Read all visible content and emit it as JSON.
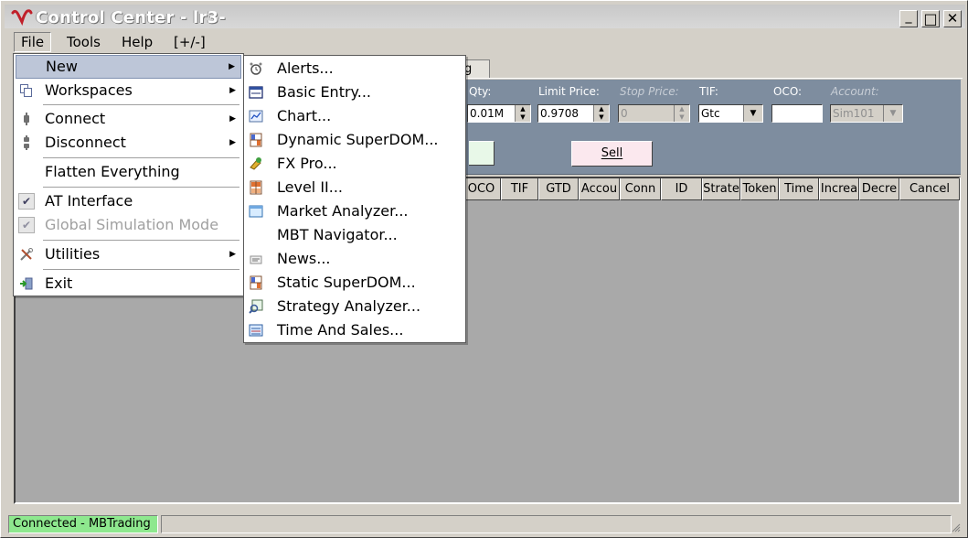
{
  "window": {
    "title": "Control Center - lr3-",
    "controls": {
      "minimize": "_",
      "maximize": "□",
      "close": "✕"
    }
  },
  "menubar": {
    "items": [
      "File",
      "Tools",
      "Help",
      "[+/-]"
    ],
    "active": "File"
  },
  "file_menu": {
    "items": [
      {
        "label": "New",
        "icon": "none",
        "submenu": true,
        "highlighted": true
      },
      {
        "label": "Workspaces",
        "icon": "copy-icon",
        "submenu": true
      },
      {
        "label": "Connect",
        "icon": "plug-icon",
        "submenu": true
      },
      {
        "label": "Disconnect",
        "icon": "unplug-icon",
        "submenu": true
      },
      {
        "label": "Flatten Everything",
        "icon": "none"
      },
      {
        "label": "AT Interface",
        "icon": "checkmark-icon",
        "checked": true
      },
      {
        "label": "Global Simulation Mode",
        "icon": "checkmark-icon",
        "checked": true,
        "disabled": true
      },
      {
        "label": "Utilities",
        "icon": "tools-icon",
        "submenu": true
      },
      {
        "label": "Exit",
        "icon": "exit-icon"
      }
    ],
    "submenu_arrow": "▶"
  },
  "new_submenu": {
    "items": [
      {
        "label": "Alerts...",
        "icon": "alarm-clock-icon"
      },
      {
        "label": "Basic Entry...",
        "icon": "basic-entry-icon"
      },
      {
        "label": "Chart...",
        "icon": "chart-icon"
      },
      {
        "label": "Dynamic SuperDOM...",
        "icon": "superdom-icon"
      },
      {
        "label": "FX Pro...",
        "icon": "fx-pro-icon"
      },
      {
        "label": "Level II...",
        "icon": "level-ii-icon"
      },
      {
        "label": "Market Analyzer...",
        "icon": "market-analyzer-icon"
      },
      {
        "label": "MBT Navigator...",
        "icon": "none"
      },
      {
        "label": "News...",
        "icon": "news-icon"
      },
      {
        "label": "Static SuperDOM...",
        "icon": "superdom-icon"
      },
      {
        "label": "Strategy Analyzer...",
        "icon": "strategy-analyzer-icon"
      },
      {
        "label": "Time And Sales...",
        "icon": "time-and-sales-icon"
      }
    ]
  },
  "tab_fragment": "g",
  "order_entry": {
    "qty_label": "Qty:",
    "qty_value": "0.01M",
    "limit_price_label": "Limit Price:",
    "limit_price_value": "0.9708",
    "stop_price_label": "Stop Price:",
    "stop_price_value": "0",
    "tif_label": "TIF:",
    "tif_value": "Gtc",
    "oco_label": "OCO:",
    "oco_value": "",
    "account_label": "Account:",
    "account_value": "Sim101",
    "sell_label": "Sell"
  },
  "orders_grid": {
    "columns": [
      "OCO",
      "TIF",
      "GTD",
      "Accou",
      "Conn",
      "ID",
      "Strate",
      "Token",
      "Time",
      "Increa",
      "Decre",
      "Cancel"
    ]
  },
  "statusbar": {
    "connection": "Connected - MBTrading"
  },
  "colors": {
    "status_connected": "#8ee88e",
    "order_panel": "#7e8d9f",
    "grid_bg": "#a9a9a9",
    "menu_highlight": "#bdc6d8",
    "sell_button": "#fbe8ee",
    "logo_red": "#c0202a"
  }
}
